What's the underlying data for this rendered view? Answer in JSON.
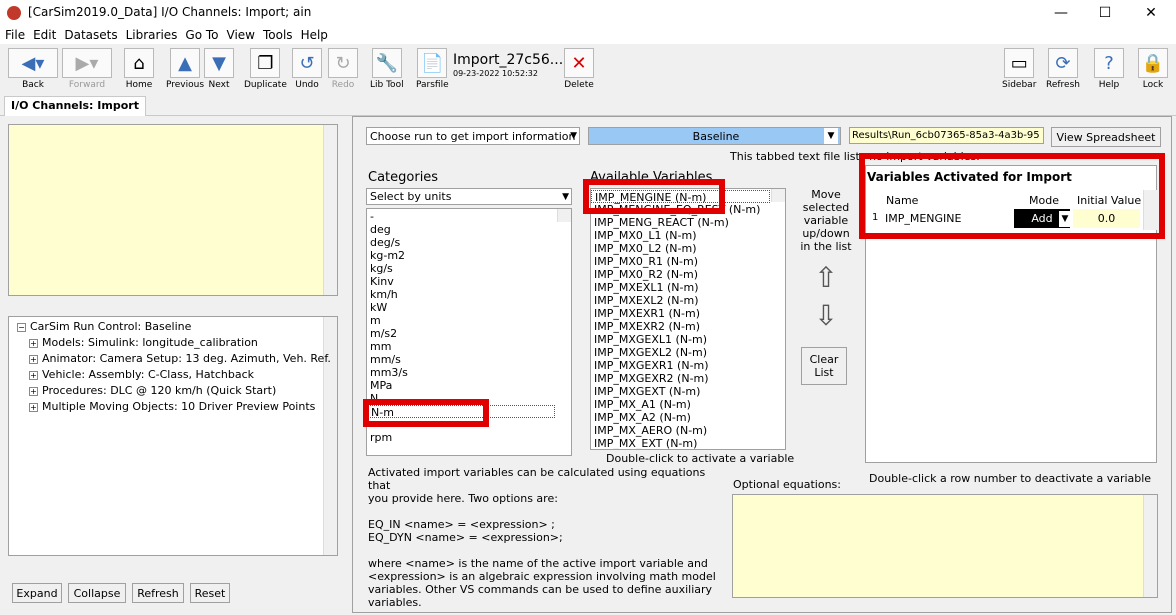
{
  "window": {
    "title": "[CarSim2019.0_Data] I/O Channels: Import; ain",
    "min": "—",
    "max": "☐",
    "close": "✕"
  },
  "menu": [
    "File",
    "Edit",
    "Datasets",
    "Libraries",
    "Go To",
    "View",
    "Tools",
    "Help"
  ],
  "toolbar": {
    "back": "Back",
    "forward": "Forward",
    "home": "Home",
    "previous": "Previous",
    "next": "Next",
    "duplicate": "Duplicate",
    "undo": "Undo",
    "redo": "Redo",
    "libtool": "Lib Tool",
    "parsfile": "Parsfile",
    "dataset_name": "Import_27c56...",
    "dataset_date": "09-23-2022 10:52:32",
    "delete": "Delete",
    "sidebar": "Sidebar",
    "refresh": "Refresh",
    "help": "Help",
    "lock": "Lock"
  },
  "tab": "I/O Channels: Import",
  "tree": {
    "root": "CarSim Run Control: Baseline",
    "items": [
      "Models: Simulink: longitude_calibration",
      "Animator: Camera Setup: 13 deg. Azimuth, Veh. Ref.",
      "Vehicle: Assembly: C-Class, Hatchback",
      "Procedures: DLC @ 120 km/h (Quick Start)",
      "Multiple Moving Objects: 10 Driver Preview Points"
    ]
  },
  "leftButtons": {
    "expand": "Expand",
    "collapse": "Collapse",
    "refresh": "Refresh",
    "reset": "Reset"
  },
  "run": {
    "choose": "Choose run to get import information",
    "baseline": "Baseline",
    "results": "Results\\Run_6cb07365-85a3-4a3b-95",
    "viewSpreadsheet": "View Spreadsheet",
    "note": "This tabbed text file lists no import variables."
  },
  "categories": {
    "label": "Categories",
    "select": "Select by units",
    "items": [
      "-",
      "deg",
      "deg/s",
      "kg-m2",
      "kg/s",
      "Kinv",
      "km/h",
      "kW",
      "m",
      "m/s2",
      "mm",
      "mm/s",
      "mm3/s",
      "MPa",
      "N",
      "N-m",
      "",
      "rpm"
    ],
    "selected": "N-m"
  },
  "available": {
    "label": "Available Variables",
    "items": [
      "IMP_MENGINE (N-m)",
      "IMP_MENGINE_EQ_REST (N-m)",
      "IMP_MENG_REACT (N-m)",
      "IMP_MX0_L1 (N-m)",
      "IMP_MX0_L2 (N-m)",
      "IMP_MX0_R1 (N-m)",
      "IMP_MX0_R2 (N-m)",
      "IMP_MXEXL1 (N-m)",
      "IMP_MXEXL2 (N-m)",
      "IMP_MXEXR1 (N-m)",
      "IMP_MXEXR2 (N-m)",
      "IMP_MXGEXL1 (N-m)",
      "IMP_MXGEXL2 (N-m)",
      "IMP_MXGEXR1 (N-m)",
      "IMP_MXGEXR2 (N-m)",
      "IMP_MXGEXT (N-m)",
      "IMP_MX_A1 (N-m)",
      "IMP_MX_A2 (N-m)",
      "IMP_MX_AERO (N-m)",
      "IMP_MX_EXT (N-m)"
    ],
    "hint": "Double-click to activate a variable"
  },
  "move": {
    "text": "Move selected variable up/down in the list",
    "clear": "Clear List",
    "up": "⇧",
    "down": "⇩"
  },
  "activated": {
    "label": "Variables Activated for Import",
    "colName": "Name",
    "colMode": "Mode",
    "colInit": "Initial Value",
    "rows": [
      {
        "num": "1",
        "name": "IMP_MENGINE",
        "mode": "Add",
        "init": "0.0"
      }
    ],
    "hint": "Double-click a row number to deactivate a variable"
  },
  "equations": {
    "label": "Optional equations:",
    "help1": "Activated import variables can be calculated using equations that",
    "help2": "you provide here. Two options are:",
    "eq1": "EQ_IN <name> = <expression> ;",
    "eq2": "EQ_DYN <name> = <expression>;",
    "help3": "where <name> is the name of the active import variable and",
    "help4": "<expression> is an algebraic expression involving math model",
    "help5": "variables. Other VS commands can be used to define auxiliary",
    "help6": "variables."
  }
}
